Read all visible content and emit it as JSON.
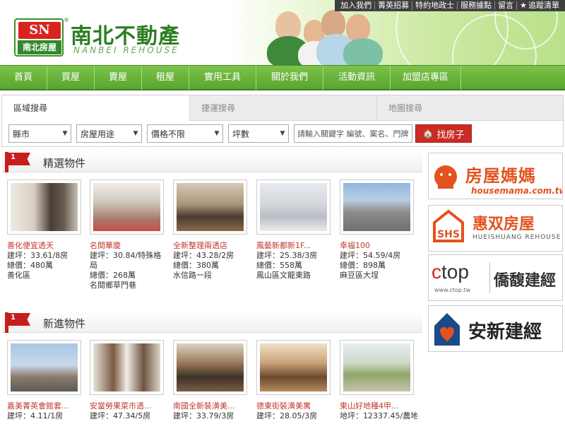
{
  "brand": {
    "logo_initials": "SN",
    "logo_sub": "南北房屋",
    "reg_mark": "®",
    "name": "南北不動產",
    "name_en": "NANBEI REHOUSE"
  },
  "toplinks": [
    "加入我們",
    "菁英招募",
    "特約地政士",
    "服務據點",
    "留言",
    "追蹤清單"
  ],
  "nav": [
    "首頁",
    "買屋",
    "賣屋",
    "租屋",
    "實用工具",
    "關於我們",
    "活動資訊",
    "加盟店專區"
  ],
  "search": {
    "tabs": [
      "區域搜尋",
      "捷運搜尋",
      "地圖搜尋"
    ],
    "selects": [
      "縣市",
      "房屋用途",
      "價格不限",
      "坪數"
    ],
    "keyword_placeholder": "請輸入關鍵字 編號、案名、門牌",
    "button": "找房子"
  },
  "featured": {
    "title": "精選物件",
    "items": [
      {
        "title": "善化便宜透天",
        "lines": [
          "建坪：33.61/8房",
          "總價：480萬",
          "善化區"
        ]
      },
      {
        "title": "名間華廈",
        "lines": [
          "建坪：30.84/特殊格局",
          "總價：268萬",
          "名間鄉草門巷"
        ]
      },
      {
        "title": "全新整理兩透店",
        "lines": [
          "建坪：43.28/2房",
          "總價：380萬",
          "水信路一段"
        ]
      },
      {
        "title": "鳳藝新都新1F...",
        "lines": [
          "建坪：25.38/3房",
          "總價：558萬",
          "鳳山區文龍東路"
        ]
      },
      {
        "title": "幸福100",
        "lines": [
          "建坪：54.59/4房",
          "總價：898萬",
          "麻豆區大埕"
        ]
      }
    ]
  },
  "newest": {
    "title": "新進物件",
    "items": [
      {
        "title": "嘉美菁英會館套...",
        "lines": [
          "建坪：4.11/1房"
        ]
      },
      {
        "title": "安當勞果菜市透...",
        "lines": [
          "建坪：47.34/5房"
        ]
      },
      {
        "title": "南國全新裝潢美...",
        "lines": [
          "建坪：33.79/3房"
        ]
      },
      {
        "title": "德東街裝潢美寓",
        "lines": [
          "建坪：28.05/3房"
        ]
      },
      {
        "title": "東山好地種4甲...",
        "lines": [
          "地坪：12337.45/農地"
        ]
      }
    ]
  },
  "ads": [
    {
      "name": "房屋媽媽",
      "sub": "housemama.com.tw",
      "color": "#e2531d"
    },
    {
      "name": "惠双房屋",
      "sub": "HUEISHUANG REHOUSE",
      "color": "#e2531d"
    },
    {
      "name": "僑馥建經",
      "sub": "www.ctop.tw",
      "logo_text": "ctop",
      "color": "#333333"
    },
    {
      "name": "安新建經",
      "color": "#1a4a8a"
    }
  ]
}
